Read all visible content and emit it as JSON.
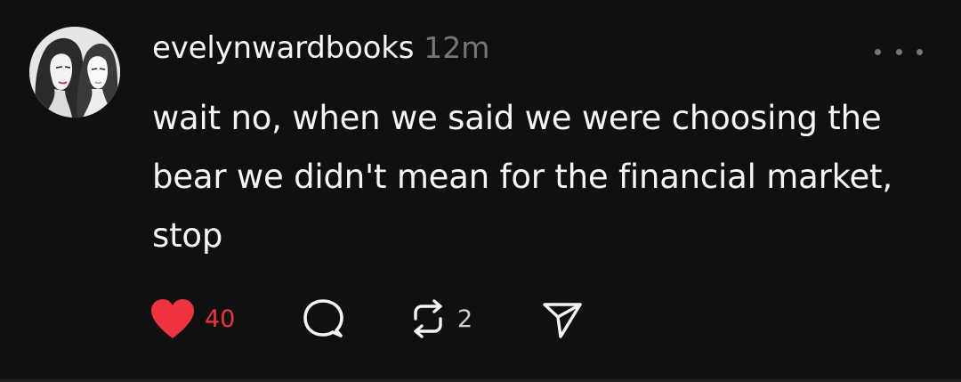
{
  "post": {
    "author": {
      "username": "evelynwardbooks",
      "avatar_icon": "avatar-illustration-two-women"
    },
    "timestamp": "12m",
    "more_icon": "more-horizontal-icon",
    "text": "wait no, when we said we were choosing the bear we didn't mean for the financial market, stop",
    "actions": {
      "like": {
        "icon": "heart-icon",
        "count": "40",
        "liked": true,
        "color": "#ef3340"
      },
      "comment": {
        "icon": "comment-bubble-icon"
      },
      "repost": {
        "icon": "repost-icon",
        "count": "2"
      },
      "share": {
        "icon": "send-icon"
      }
    }
  },
  "colors": {
    "background": "#101010",
    "text_primary": "#f3f5f7",
    "text_secondary": "#777777",
    "like": "#ef3340"
  }
}
